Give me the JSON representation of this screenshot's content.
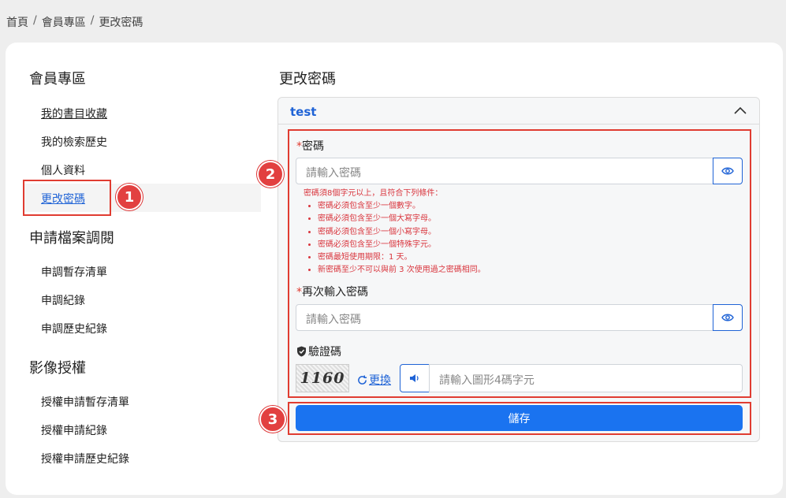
{
  "breadcrumb": [
    "首頁",
    "會員專區",
    "更改密碼"
  ],
  "sidebar": {
    "section1": {
      "title": "會員專區",
      "items": [
        "我的書目收藏",
        "我的檢索歷史",
        "個人資料",
        "更改密碼"
      ]
    },
    "section2": {
      "title": "申請檔案調閱",
      "items": [
        "申調暫存清單",
        "申調紀錄",
        "申調歷史紀錄"
      ]
    },
    "section3": {
      "title": "影像授權",
      "items": [
        "授權申請暫存清單",
        "授權申請紀錄",
        "授權申請歷史紀錄"
      ]
    }
  },
  "badges": [
    "1",
    "2",
    "3"
  ],
  "main": {
    "title": "更改密碼",
    "account": "test",
    "password": {
      "label": "密碼",
      "required_mark": "*",
      "placeholder": "請輸入密碼"
    },
    "rules": {
      "intro": "密碼須8個字元以上，且符合下列條件：",
      "items": [
        "密碼必須包含至少一個數字。",
        "密碼必須包含至少一個大寫字母。",
        "密碼必須包含至少一個小寫字母。",
        "密碼必須包含至少一個特殊字元。",
        "密碼最短使用期限：1 天。",
        "新密碼至少不可以與前 3 次使用過之密碼相同。"
      ]
    },
    "confirm": {
      "label": "再次輸入密碼",
      "required_mark": "*",
      "placeholder": "請輸入密碼"
    },
    "captcha": {
      "label": "驗證碼",
      "image_text": "1160",
      "refresh_label": "更換",
      "placeholder": "請輸入圖形4碼字元"
    },
    "save_label": "儲存"
  },
  "colors": {
    "accent": "#1a73f0",
    "link": "#1f63d6",
    "highlight": "#e03c31",
    "rule_text": "#d9363e"
  }
}
